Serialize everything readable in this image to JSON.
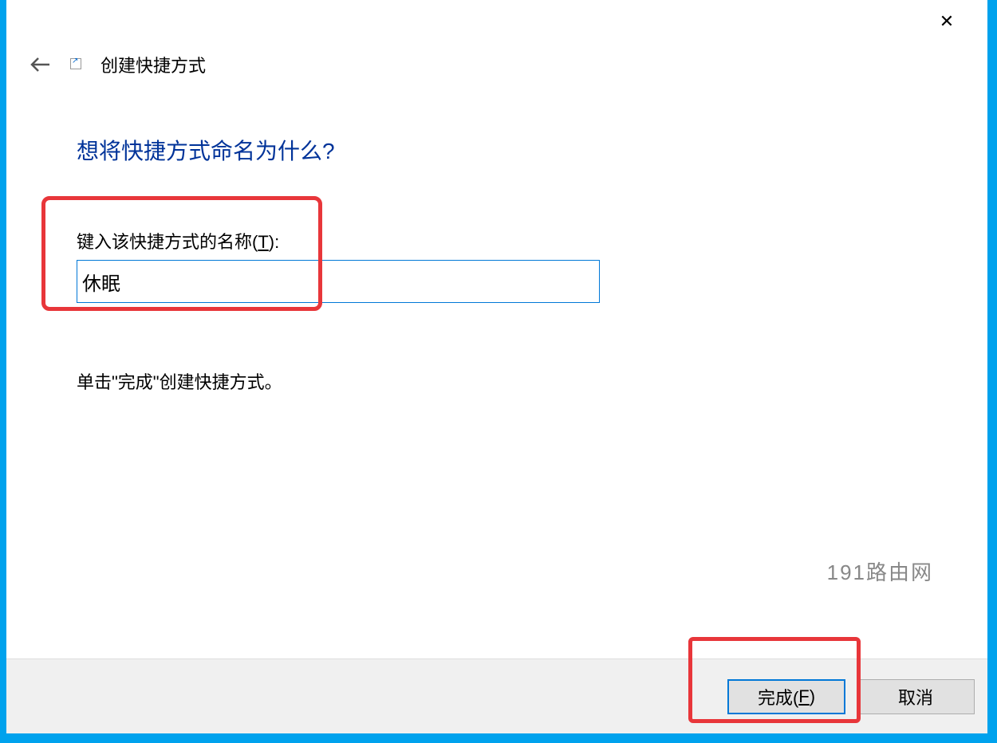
{
  "window": {
    "close_icon": "✕"
  },
  "header": {
    "title": "创建快捷方式"
  },
  "content": {
    "question": "想将快捷方式命名为什么?",
    "field_label_prefix": "键入该快捷方式的名称(",
    "field_label_accel": "T",
    "field_label_suffix": "):",
    "input_value": "休眠",
    "instruction": "单击\"完成\"创建快捷方式。"
  },
  "watermark": "191路由网",
  "footer": {
    "finish_prefix": "完成(",
    "finish_accel": "F",
    "finish_suffix": ")",
    "cancel": "取消"
  }
}
